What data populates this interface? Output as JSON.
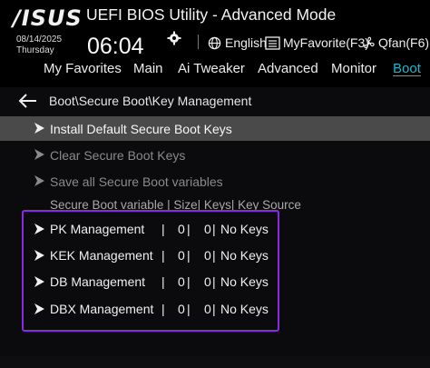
{
  "header": {
    "logo": "/ISUS",
    "title": "UEFI BIOS Utility - Advanced Mode",
    "date": "08/14/2025",
    "day": "Thursday",
    "time": "06:04",
    "language": "English",
    "favorite": "MyFavorite(F3)",
    "qfan": "Qfan(F6)"
  },
  "tabs": [
    {
      "label": "My Favorites"
    },
    {
      "label": "Main"
    },
    {
      "label": "Ai Tweaker"
    },
    {
      "label": "Advanced"
    },
    {
      "label": "Monitor"
    },
    {
      "label": "Boot",
      "active": true
    }
  ],
  "breadcrumb": "Boot\\Secure Boot\\Key Management",
  "menu": {
    "install_default": "Install Default Secure Boot Keys",
    "clear": "Clear Secure Boot Keys",
    "save_all": "Save all Secure Boot variables",
    "column_header": "Secure Boot variable  |  Size|  Keys|  Key Source"
  },
  "key_rows": [
    {
      "name": "PK Management",
      "size": "0",
      "keys": "0",
      "source": "No Keys"
    },
    {
      "name": "KEK Management",
      "size": "0",
      "keys": "0",
      "source": "No Keys"
    },
    {
      "name": "DB Management",
      "size": "0",
      "keys": "0",
      "source": "No Keys"
    },
    {
      "name": "DBX Management",
      "size": "0",
      "keys": "0",
      "source": "No Keys"
    }
  ],
  "colors": {
    "accent": "#23b2c8",
    "selected_row": "#4a4a4a",
    "highlight_border": "#8a2be2",
    "disabled_text": "#8a8a8a"
  },
  "icons": [
    "gear-icon",
    "globe-icon",
    "favorite-list-icon",
    "fan-icon",
    "back-arrow-icon",
    "chevron-right-icon"
  ]
}
